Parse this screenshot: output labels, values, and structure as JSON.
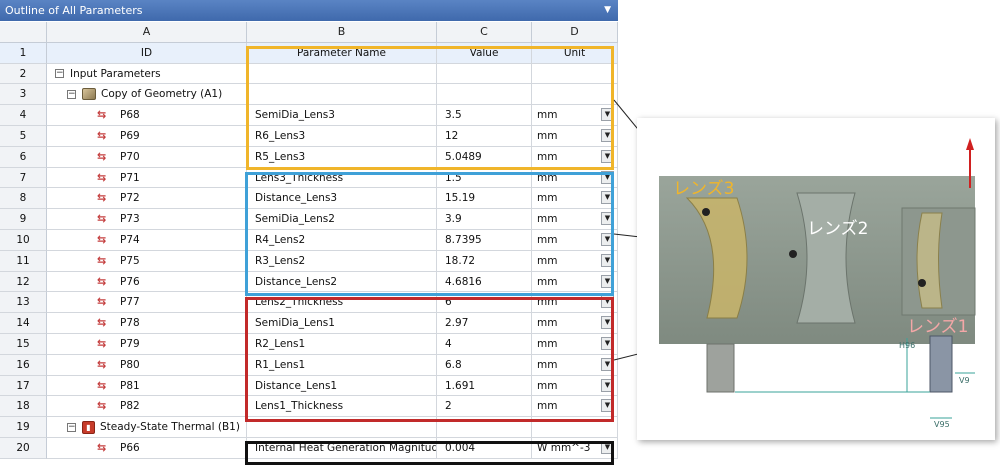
{
  "window": {
    "title": "Outline of All Parameters",
    "pin_glyph": "▼"
  },
  "columns": {
    "letters": [
      "A",
      "B",
      "C",
      "D"
    ]
  },
  "rows": [
    {
      "num": "1",
      "kind": "colheader",
      "a": "ID",
      "b": "Parameter Name",
      "c": "Value",
      "d": "Unit"
    },
    {
      "num": "2",
      "kind": "group",
      "a": "Input Parameters",
      "icon": "expander-icon"
    },
    {
      "num": "3",
      "kind": "subgroup",
      "a": "Copy of Geometry (A1)",
      "icon": "geometry-icon"
    },
    {
      "num": "4",
      "kind": "param",
      "a": "P68",
      "b": "SemiDia_Lens3",
      "c": "3.5",
      "d": "mm"
    },
    {
      "num": "5",
      "kind": "param",
      "a": "P69",
      "b": "R6_Lens3",
      "c": "12",
      "d": "mm"
    },
    {
      "num": "6",
      "kind": "param",
      "a": "P70",
      "b": "R5_Lens3",
      "c": "5.0489",
      "d": "mm"
    },
    {
      "num": "7",
      "kind": "param",
      "a": "P71",
      "b": "Lens3_Thickness",
      "c": "1.5",
      "d": "mm"
    },
    {
      "num": "8",
      "kind": "param",
      "a": "P72",
      "b": "Distance_Lens3",
      "c": "15.19",
      "d": "mm"
    },
    {
      "num": "9",
      "kind": "param",
      "a": "P73",
      "b": "SemiDia_Lens2",
      "c": "3.9",
      "d": "mm"
    },
    {
      "num": "10",
      "kind": "param",
      "a": "P74",
      "b": "R4_Lens2",
      "c": "8.7395",
      "d": "mm"
    },
    {
      "num": "11",
      "kind": "param",
      "a": "P75",
      "b": "R3_Lens2",
      "c": "18.72",
      "d": "mm"
    },
    {
      "num": "12",
      "kind": "param",
      "a": "P76",
      "b": "Distance_Lens2",
      "c": "4.6816",
      "d": "mm"
    },
    {
      "num": "13",
      "kind": "param",
      "a": "P77",
      "b": "Lens2_Thickness",
      "c": "6",
      "d": "mm"
    },
    {
      "num": "14",
      "kind": "param",
      "a": "P78",
      "b": "SemiDia_Lens1",
      "c": "2.97",
      "d": "mm"
    },
    {
      "num": "15",
      "kind": "param",
      "a": "P79",
      "b": "R2_Lens1",
      "c": "4",
      "d": "mm"
    },
    {
      "num": "16",
      "kind": "param",
      "a": "P80",
      "b": "R1_Lens1",
      "c": "6.8",
      "d": "mm"
    },
    {
      "num": "17",
      "kind": "param",
      "a": "P81",
      "b": "Distance_Lens1",
      "c": "1.691",
      "d": "mm"
    },
    {
      "num": "18",
      "kind": "param",
      "a": "P82",
      "b": "Lens1_Thickness",
      "c": "2",
      "d": "mm"
    },
    {
      "num": "19",
      "kind": "subgroup",
      "a": "Steady-State Thermal (B1)",
      "icon": "thermal-icon"
    },
    {
      "num": "20",
      "kind": "param",
      "a": "P66",
      "b": "Internal Heat Generation Magnitude",
      "c": "0.004",
      "d": "W mm^-3"
    }
  ],
  "model_view": {
    "labels": {
      "lens3": "レンズ3",
      "lens2": "レンズ2",
      "lens1": "レンズ1"
    },
    "dimensions": {
      "h96": "H96",
      "v95": "V95",
      "v9": "V9"
    }
  },
  "colors": {
    "lens3_box": "#f0b52a",
    "lens2_box": "#3fa1d8",
    "lens1_box": "#c22a2a",
    "heat_box": "#111111"
  }
}
